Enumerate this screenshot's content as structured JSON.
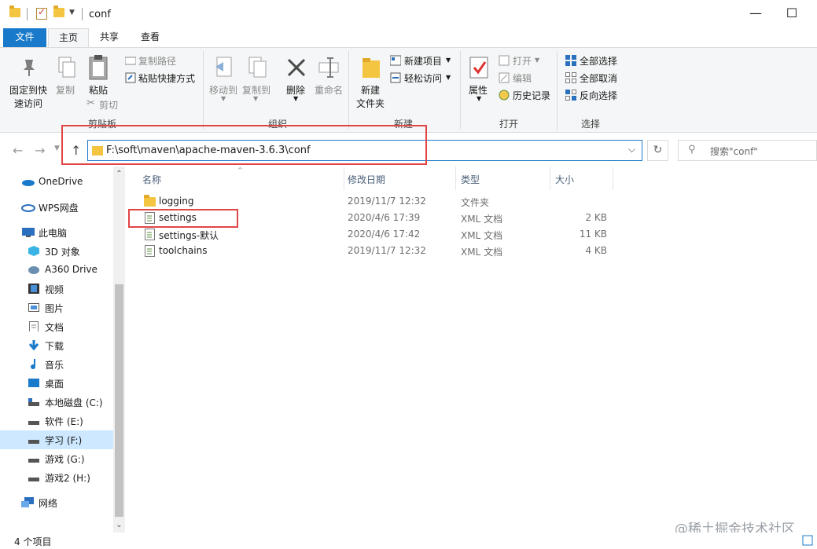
{
  "window": {
    "title": "conf",
    "minimize": "—",
    "maximize": "☐"
  },
  "tabs": {
    "file": "文件",
    "home": "主页",
    "share": "共享",
    "view": "查看"
  },
  "ribbon": {
    "clipboard": {
      "pin_label_1": "固定到快",
      "pin_label_2": "速访问",
      "copy": "复制",
      "paste": "粘贴",
      "copy_path": "复制路径",
      "paste_shortcut": "粘贴快捷方式",
      "cut": "剪切",
      "group": "剪贴板"
    },
    "organize": {
      "move_to": "移动到",
      "copy_to": "复制到",
      "delete": "删除",
      "rename": "重命名",
      "group": "组织"
    },
    "new": {
      "new_folder_1": "新建",
      "new_folder_2": "文件夹",
      "new_item": "新建项目",
      "easy_access": "轻松访问",
      "group": "新建"
    },
    "open": {
      "properties": "属性",
      "open": "打开",
      "edit": "编辑",
      "history": "历史记录",
      "group": "打开"
    },
    "select": {
      "select_all": "全部选择",
      "select_none": "全部取消",
      "invert": "反向选择",
      "group": "选择"
    }
  },
  "address": {
    "path": "F:\\soft\\maven\\apache-maven-3.6.3\\conf"
  },
  "search": {
    "placeholder": "搜索\"conf\""
  },
  "sidebar": {
    "items": [
      {
        "label": "OneDrive",
        "icon": "cloud-icon"
      },
      {
        "label": "WPS网盘",
        "icon": "cloud-icon"
      },
      {
        "label": "此电脑",
        "icon": "computer-icon"
      },
      {
        "label": "3D 对象",
        "icon": "cube-icon"
      },
      {
        "label": "A360 Drive",
        "icon": "drive-icon"
      },
      {
        "label": "视频",
        "icon": "video-icon"
      },
      {
        "label": "图片",
        "icon": "picture-icon"
      },
      {
        "label": "文档",
        "icon": "document-icon"
      },
      {
        "label": "下载",
        "icon": "download-icon"
      },
      {
        "label": "音乐",
        "icon": "music-icon"
      },
      {
        "label": "桌面",
        "icon": "desktop-icon"
      },
      {
        "label": "本地磁盘 (C:)",
        "icon": "disk-icon"
      },
      {
        "label": "软件 (E:)",
        "icon": "disk-icon"
      },
      {
        "label": "学习 (F:)",
        "icon": "disk-icon"
      },
      {
        "label": "游戏 (G:)",
        "icon": "disk-icon"
      },
      {
        "label": "游戏2 (H:)",
        "icon": "disk-icon"
      },
      {
        "label": "网络",
        "icon": "network-icon"
      }
    ]
  },
  "columns": {
    "name": "名称",
    "modified": "修改日期",
    "type": "类型",
    "size": "大小"
  },
  "files": [
    {
      "name": "logging",
      "modified": "2019/11/7 12:32",
      "type": "文件夹",
      "size": ""
    },
    {
      "name": "settings",
      "modified": "2020/4/6 17:39",
      "type": "XML 文档",
      "size": "2 KB"
    },
    {
      "name": "settings-默认",
      "modified": "2020/4/6 17:42",
      "type": "XML 文档",
      "size": "11 KB"
    },
    {
      "name": "toolchains",
      "modified": "2019/11/7 12:32",
      "type": "XML 文档",
      "size": "4 KB"
    }
  ],
  "status": {
    "count": "4 个项目"
  },
  "watermark": "@稀土掘金技术社区",
  "colors": {
    "accent": "#1979ca",
    "highlight": "#e04646",
    "selected": "#cde8ff"
  }
}
